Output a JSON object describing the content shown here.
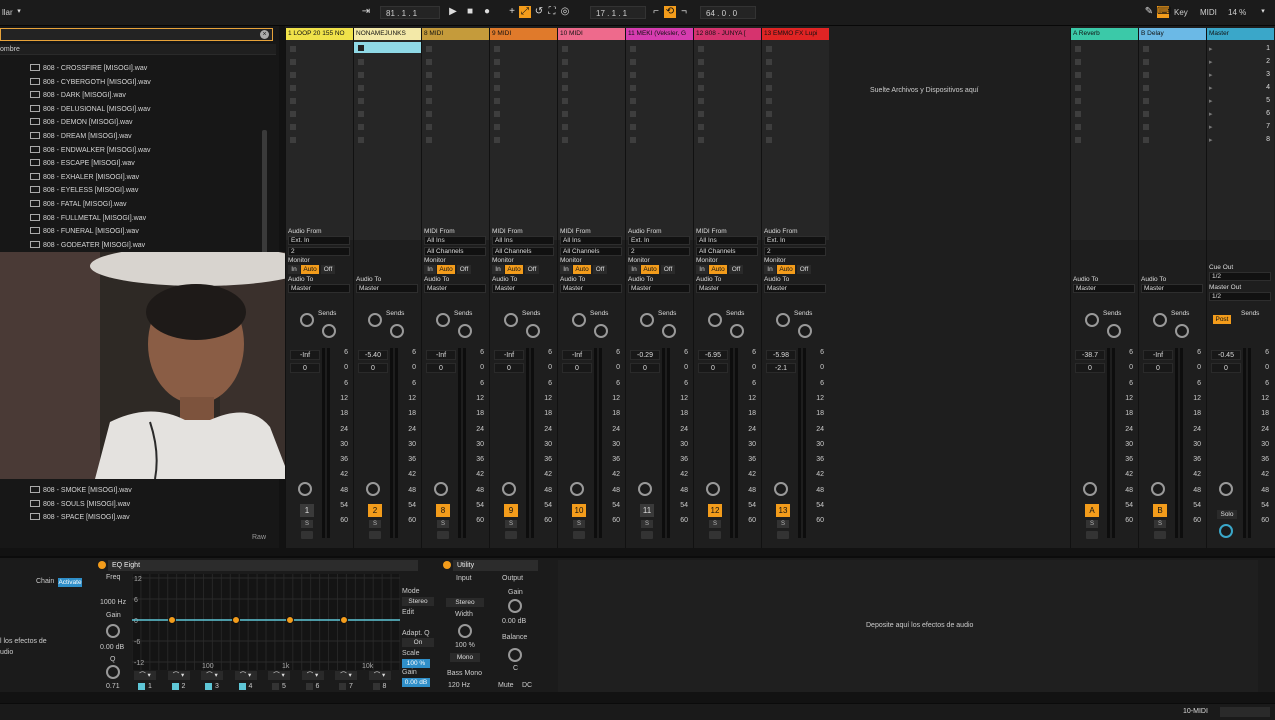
{
  "topbar": {
    "left_text": "llar",
    "arrangement_pos": "81 .  1 .  1",
    "loop_start": "17 .  1 .  1",
    "loop_len": "64 .  0 .  0",
    "key_label": "Key",
    "midi_label": "MIDI",
    "cpu": "14 %"
  },
  "browser": {
    "header": "ombre",
    "files_top": [
      "808 - CROSSFIRE [MISOGI].wav",
      "808 - CYBERGOTH [MISOGI].wav",
      "808 - DARK [MISOGI].wav",
      "808 - DELUSIONAL [MISOGI].wav",
      "808 - DEMON [MISOGI].wav",
      "808 - DREAM [MISOGI].wav",
      "808 - ENDWALKER [MISOGI].wav",
      "808 - ESCAPE [MISOGI].wav",
      "808 - EXHALER [MISOGI].wav",
      "808 - EYELESS [MISOGI].wav",
      "808 - FATAL [MISOGI].wav",
      "808 - FULLMETAL [MISOGI].wav",
      "808 - FUNERAL [MISOGI].wav",
      "808 - GODEATER [MISOGI].wav"
    ],
    "files_bottom": [
      "808 - SMOKE [MISOGI].wav",
      "808 - SOULS [MISOGI].wav",
      "808 - SPACE [MISOGI].wav"
    ],
    "raw": "Raw"
  },
  "session": {
    "drop_files": "Suelte Archivos y Dispositivos aquí",
    "tracks": [
      {
        "name": "1 LOOP 20 155 NO",
        "color": "#f0e24a",
        "from": "Audio From",
        "from_sel": "Ext. In",
        "ch": "2",
        "to_sel": "Master",
        "vol": "-Inf",
        "pan": "0",
        "num": "1",
        "armed": false
      },
      {
        "name": "NONAMEJUNKS",
        "color": "#f3e9a8",
        "from": "",
        "from_sel": "",
        "ch": "",
        "to_sel": "Master",
        "vol": "-5.40",
        "pan": "0",
        "num": "2",
        "armed": true
      },
      {
        "name": "8 MIDI",
        "color": "#c59b3b",
        "from": "MIDI From",
        "from_sel": "All Ins",
        "ch": "All Channels",
        "to_sel": "Master",
        "vol": "-Inf",
        "pan": "0",
        "num": "8",
        "armed": true
      },
      {
        "name": "9 MIDI",
        "color": "#e07a2b",
        "from": "MIDI From",
        "from_sel": "All Ins",
        "ch": "All Channels",
        "to_sel": "Master",
        "vol": "-Inf",
        "pan": "0",
        "num": "9",
        "armed": true
      },
      {
        "name": "10 MIDI",
        "color": "#ee6a8c",
        "from": "MIDI From",
        "from_sel": "All Ins",
        "ch": "All Channels",
        "to_sel": "Master",
        "vol": "-Inf",
        "pan": "0",
        "num": "10",
        "armed": true
      },
      {
        "name": "11 MEKI (Veksler, G",
        "color": "#d63cb0",
        "from": "Audio From",
        "from_sel": "Ext. In",
        "ch": "2",
        "to_sel": "Master",
        "vol": "-0.29",
        "pan": "0",
        "num": "11",
        "armed": false
      },
      {
        "name": "12 808 - JUNYA [",
        "color": "#d6336e",
        "from": "MIDI From",
        "from_sel": "All Ins",
        "ch": "All Channels",
        "to_sel": "Master",
        "vol": "-6.95",
        "pan": "0",
        "num": "12",
        "armed": true
      },
      {
        "name": "13 EMMO FX Lupi",
        "color": "#e02424",
        "from": "Audio From",
        "from_sel": "Ext. In",
        "ch": "2",
        "to_sel": "Master",
        "vol": "-5.98",
        "pan": "-2.1",
        "num": "13",
        "armed": true
      }
    ],
    "returns": [
      {
        "name": "A Reverb",
        "color": "#3bc9a8",
        "to_sel": "Master",
        "vol": "-38.7",
        "pan": "0",
        "num": "A"
      },
      {
        "name": "B Delay",
        "color": "#6bb9e6",
        "to_sel": "Master",
        "vol": "-Inf",
        "pan": "0",
        "num": "B"
      }
    ],
    "master": {
      "name": "Master",
      "color": "#3aa7c9",
      "cue_out": "Cue Out",
      "cue_sel": "1/2",
      "master_out": "Master Out",
      "master_sel": "1/2",
      "vol": "-0.45",
      "pan": "0",
      "solo": "Solo",
      "post": "Post"
    },
    "labels": {
      "monitor": "Monitor",
      "in": "In",
      "auto": "Auto",
      "off": "Off",
      "audio_to": "Audio To",
      "sends": "Sends",
      "a": "A",
      "b": "B",
      "s": "S"
    },
    "scale": [
      "6",
      "0",
      "6",
      "12",
      "18",
      "24",
      "30",
      "36",
      "42",
      "48",
      "54",
      "60"
    ],
    "scenes": [
      "1",
      "2",
      "3",
      "4",
      "5",
      "6",
      "7",
      "8"
    ]
  },
  "device": {
    "chain_label": "Chain",
    "chain_btn": "Activate",
    "rack_hint_1": "l los efectos de",
    "rack_hint_2": "udio",
    "eq": {
      "title": "EQ Eight",
      "freq_label": "Freq",
      "freq_val": "1000 Hz",
      "gain_label": "Gain",
      "gain_val": "0.00 dB",
      "q_label": "Q",
      "q_val": "0.71",
      "mode_label": "Mode",
      "mode_val": "Stereo",
      "edit_label": "Edit",
      "adapt_label": "Adapt. Q",
      "adapt_val": "On",
      "scale_label": "Scale",
      "scale_val": "100 %",
      "gain2_label": "Gain",
      "gain2_val": "0.00 dB",
      "db_ticks": [
        "12",
        "6",
        "0",
        "-6",
        "-12"
      ],
      "freq_ticks": [
        "100",
        "1k",
        "10k"
      ],
      "bands": [
        "1",
        "2",
        "3",
        "4",
        "5",
        "6",
        "7",
        "8"
      ]
    },
    "utility": {
      "title": "Utility",
      "input": "Input",
      "output": "Output",
      "gain": "Gain",
      "gain_val": "0.00 dB",
      "width": "Width",
      "width_val": "100 %",
      "mono": "Mono",
      "balance": "Balance",
      "balance_val": "C",
      "bass_mono": "Bass Mono",
      "bass_val": "120 Hz",
      "mute": "Mute",
      "dc": "DC",
      "stereo": "Stereo"
    },
    "drop_fx": "Deposite aquí los efectos de audio"
  },
  "status": {
    "right": "10-MIDI"
  }
}
